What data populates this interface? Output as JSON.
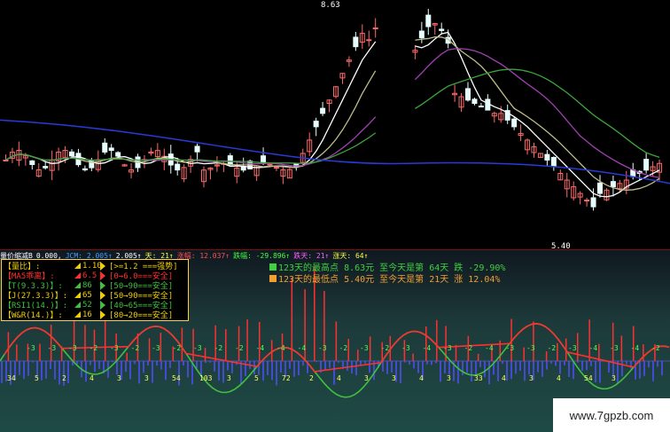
{
  "colors": {
    "up": "#ff6a6a",
    "down": "#e8ffff",
    "ma_long": "#2a3ad8",
    "ma_mid": "#bdbd8a",
    "ma_short": "#ffffff",
    "ma_green": "#3aa63a",
    "ma_purple": "#a040b0",
    "kline_red": "#ff3030",
    "kline_green": "#40c040",
    "bar_blue": "#5050ff",
    "panel_accent": "#ffd040"
  },
  "price_chart": {
    "high_label": "8.63",
    "low_label": "5.40"
  },
  "info_strip": {
    "title": "量价缩减B",
    "items": [
      "0.000,",
      "JCM: 2.005↑",
      "2.005↑",
      "天: 21↑",
      "涨幅: 12.037↑",
      "跌幅: -29.896↑",
      "跌天: 21↑",
      "涨天: 64↑"
    ]
  },
  "indicator_panel": {
    "rows": [
      {
        "name": "【量比】:",
        "value": "1.10",
        "range": "[>=1.2 ===强势]",
        "color": "#f0d000"
      },
      {
        "name": "【MA5乖离】:",
        "value": "6.5",
        "range": "[0→6.0===安全]",
        "color": "#ff3030"
      },
      {
        "name": "【T(9.3.3)】:",
        "value": "86",
        "range": "[50→90===安全]",
        "color": "#40c040"
      },
      {
        "name": "【J(27.3.3)】:",
        "value": "65",
        "range": "[50→90===安全]",
        "color": "#f0d000"
      },
      {
        "name": "【RSI1(14.)】:",
        "value": "52",
        "range": "[40→65===安全]",
        "color": "#40c040"
      },
      {
        "name": "【W&R(14.)】:",
        "value": "16",
        "range": "[80→20===安全]",
        "color": "#f0d000"
      }
    ]
  },
  "extremes": {
    "high_text": "123天的最高点  8.63元  至今天是第  64天  跌  -29.90%",
    "low_text": "123天的最低点  5.40元  至今天是第  21天  涨  12.04%"
  },
  "sub_labels": {
    "upper": [
      "-3",
      "-3",
      "-3",
      "-2",
      "-3",
      "-2",
      "-3",
      "-2",
      "-3",
      "-2",
      "-2",
      "-4",
      "-4",
      "-4",
      "-3",
      "-2",
      "-3",
      "-2",
      "-3",
      "-4",
      "-3",
      "-2",
      "-4",
      "-3",
      "-3",
      "-2",
      "-3",
      "-4",
      "-3",
      "-4",
      "-2"
    ],
    "lower": [
      "34",
      "5",
      "2",
      "4",
      "3",
      "3",
      "54",
      "103",
      "3",
      "5",
      "72",
      "2",
      "4",
      "3",
      "3",
      "4",
      "3",
      "33",
      "4",
      "3",
      "4",
      "54",
      "3"
    ]
  },
  "watermark": "www.7gpzb.com"
}
